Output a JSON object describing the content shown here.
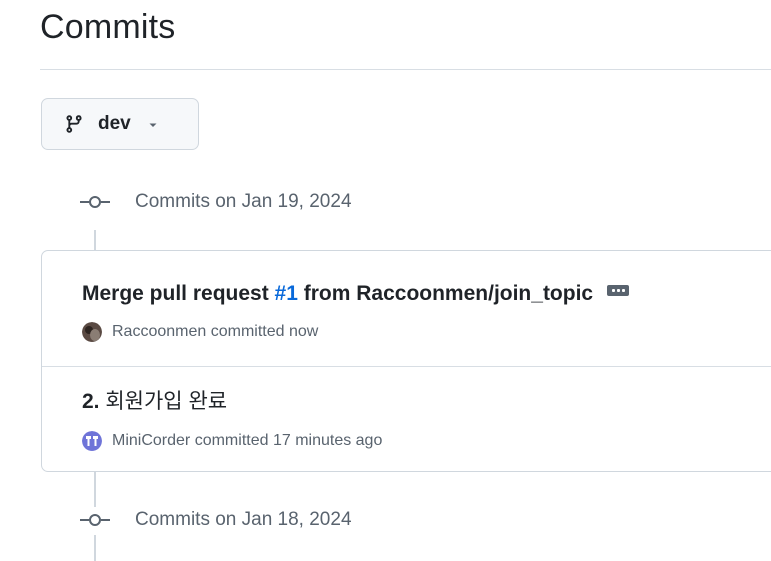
{
  "page": {
    "title": "Commits"
  },
  "branch": {
    "label": "dev"
  },
  "groups": [
    {
      "label": "Commits on Jan 19, 2024"
    },
    {
      "label": "Commits on Jan 18, 2024"
    }
  ],
  "commits": [
    {
      "title_prefix": "Merge pull request ",
      "pr_number": "#1",
      "title_suffix": " from Raccoonmen/join_topic",
      "author": "Raccoonmen",
      "committed_text": "committed now"
    },
    {
      "number": "2.",
      "title": " 회원가입 완료",
      "author": "MiniCorder",
      "committed_text": "committed 17 minutes ago"
    }
  ],
  "icons": {
    "branch": "git-branch-icon",
    "caret": "caret-down-icon",
    "commit": "git-commit-icon",
    "more": "ellipsis-icon"
  },
  "colors": {
    "link": "#0969da",
    "muted": "#59636e",
    "border": "#d0d7de"
  }
}
